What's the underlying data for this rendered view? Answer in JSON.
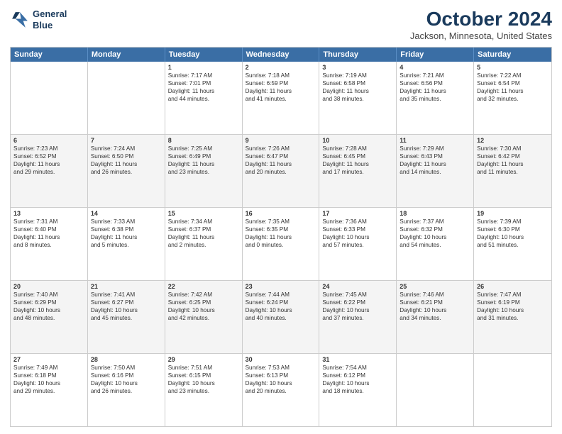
{
  "header": {
    "logo_line1": "General",
    "logo_line2": "Blue",
    "title": "October 2024",
    "subtitle": "Jackson, Minnesota, United States"
  },
  "calendar": {
    "days": [
      "Sunday",
      "Monday",
      "Tuesday",
      "Wednesday",
      "Thursday",
      "Friday",
      "Saturday"
    ],
    "rows": [
      [
        {
          "day": "",
          "empty": true
        },
        {
          "day": "",
          "empty": true
        },
        {
          "day": "1",
          "lines": [
            "Sunrise: 7:17 AM",
            "Sunset: 7:01 PM",
            "Daylight: 11 hours",
            "and 44 minutes."
          ]
        },
        {
          "day": "2",
          "lines": [
            "Sunrise: 7:18 AM",
            "Sunset: 6:59 PM",
            "Daylight: 11 hours",
            "and 41 minutes."
          ]
        },
        {
          "day": "3",
          "lines": [
            "Sunrise: 7:19 AM",
            "Sunset: 6:58 PM",
            "Daylight: 11 hours",
            "and 38 minutes."
          ]
        },
        {
          "day": "4",
          "lines": [
            "Sunrise: 7:21 AM",
            "Sunset: 6:56 PM",
            "Daylight: 11 hours",
            "and 35 minutes."
          ]
        },
        {
          "day": "5",
          "lines": [
            "Sunrise: 7:22 AM",
            "Sunset: 6:54 PM",
            "Daylight: 11 hours",
            "and 32 minutes."
          ]
        }
      ],
      [
        {
          "day": "6",
          "lines": [
            "Sunrise: 7:23 AM",
            "Sunset: 6:52 PM",
            "Daylight: 11 hours",
            "and 29 minutes."
          ]
        },
        {
          "day": "7",
          "lines": [
            "Sunrise: 7:24 AM",
            "Sunset: 6:50 PM",
            "Daylight: 11 hours",
            "and 26 minutes."
          ]
        },
        {
          "day": "8",
          "lines": [
            "Sunrise: 7:25 AM",
            "Sunset: 6:49 PM",
            "Daylight: 11 hours",
            "and 23 minutes."
          ]
        },
        {
          "day": "9",
          "lines": [
            "Sunrise: 7:26 AM",
            "Sunset: 6:47 PM",
            "Daylight: 11 hours",
            "and 20 minutes."
          ]
        },
        {
          "day": "10",
          "lines": [
            "Sunrise: 7:28 AM",
            "Sunset: 6:45 PM",
            "Daylight: 11 hours",
            "and 17 minutes."
          ]
        },
        {
          "day": "11",
          "lines": [
            "Sunrise: 7:29 AM",
            "Sunset: 6:43 PM",
            "Daylight: 11 hours",
            "and 14 minutes."
          ]
        },
        {
          "day": "12",
          "lines": [
            "Sunrise: 7:30 AM",
            "Sunset: 6:42 PM",
            "Daylight: 11 hours",
            "and 11 minutes."
          ]
        }
      ],
      [
        {
          "day": "13",
          "lines": [
            "Sunrise: 7:31 AM",
            "Sunset: 6:40 PM",
            "Daylight: 11 hours",
            "and 8 minutes."
          ]
        },
        {
          "day": "14",
          "lines": [
            "Sunrise: 7:33 AM",
            "Sunset: 6:38 PM",
            "Daylight: 11 hours",
            "and 5 minutes."
          ]
        },
        {
          "day": "15",
          "lines": [
            "Sunrise: 7:34 AM",
            "Sunset: 6:37 PM",
            "Daylight: 11 hours",
            "and 2 minutes."
          ]
        },
        {
          "day": "16",
          "lines": [
            "Sunrise: 7:35 AM",
            "Sunset: 6:35 PM",
            "Daylight: 11 hours",
            "and 0 minutes."
          ]
        },
        {
          "day": "17",
          "lines": [
            "Sunrise: 7:36 AM",
            "Sunset: 6:33 PM",
            "Daylight: 10 hours",
            "and 57 minutes."
          ]
        },
        {
          "day": "18",
          "lines": [
            "Sunrise: 7:37 AM",
            "Sunset: 6:32 PM",
            "Daylight: 10 hours",
            "and 54 minutes."
          ]
        },
        {
          "day": "19",
          "lines": [
            "Sunrise: 7:39 AM",
            "Sunset: 6:30 PM",
            "Daylight: 10 hours",
            "and 51 minutes."
          ]
        }
      ],
      [
        {
          "day": "20",
          "lines": [
            "Sunrise: 7:40 AM",
            "Sunset: 6:29 PM",
            "Daylight: 10 hours",
            "and 48 minutes."
          ]
        },
        {
          "day": "21",
          "lines": [
            "Sunrise: 7:41 AM",
            "Sunset: 6:27 PM",
            "Daylight: 10 hours",
            "and 45 minutes."
          ]
        },
        {
          "day": "22",
          "lines": [
            "Sunrise: 7:42 AM",
            "Sunset: 6:25 PM",
            "Daylight: 10 hours",
            "and 42 minutes."
          ]
        },
        {
          "day": "23",
          "lines": [
            "Sunrise: 7:44 AM",
            "Sunset: 6:24 PM",
            "Daylight: 10 hours",
            "and 40 minutes."
          ]
        },
        {
          "day": "24",
          "lines": [
            "Sunrise: 7:45 AM",
            "Sunset: 6:22 PM",
            "Daylight: 10 hours",
            "and 37 minutes."
          ]
        },
        {
          "day": "25",
          "lines": [
            "Sunrise: 7:46 AM",
            "Sunset: 6:21 PM",
            "Daylight: 10 hours",
            "and 34 minutes."
          ]
        },
        {
          "day": "26",
          "lines": [
            "Sunrise: 7:47 AM",
            "Sunset: 6:19 PM",
            "Daylight: 10 hours",
            "and 31 minutes."
          ]
        }
      ],
      [
        {
          "day": "27",
          "lines": [
            "Sunrise: 7:49 AM",
            "Sunset: 6:18 PM",
            "Daylight: 10 hours",
            "and 29 minutes."
          ]
        },
        {
          "day": "28",
          "lines": [
            "Sunrise: 7:50 AM",
            "Sunset: 6:16 PM",
            "Daylight: 10 hours",
            "and 26 minutes."
          ]
        },
        {
          "day": "29",
          "lines": [
            "Sunrise: 7:51 AM",
            "Sunset: 6:15 PM",
            "Daylight: 10 hours",
            "and 23 minutes."
          ]
        },
        {
          "day": "30",
          "lines": [
            "Sunrise: 7:53 AM",
            "Sunset: 6:13 PM",
            "Daylight: 10 hours",
            "and 20 minutes."
          ]
        },
        {
          "day": "31",
          "lines": [
            "Sunrise: 7:54 AM",
            "Sunset: 6:12 PM",
            "Daylight: 10 hours",
            "and 18 minutes."
          ]
        },
        {
          "day": "",
          "empty": true
        },
        {
          "day": "",
          "empty": true
        }
      ]
    ]
  }
}
